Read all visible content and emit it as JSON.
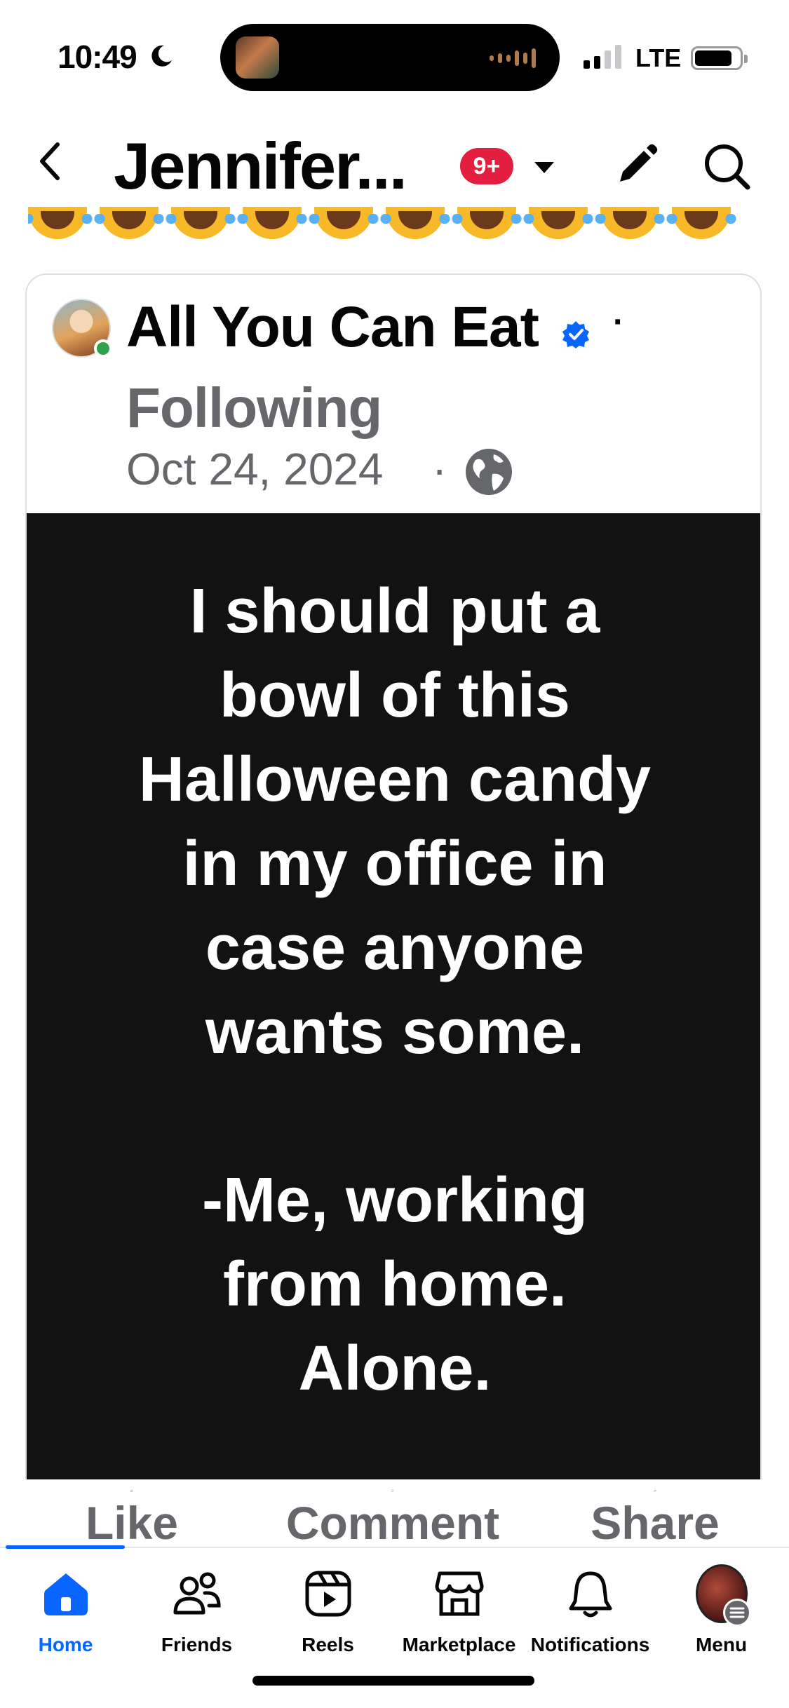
{
  "status_bar": {
    "time": "10:49",
    "network": "LTE"
  },
  "header": {
    "title": "Jennifer...",
    "badge": "9+"
  },
  "post": {
    "page_name": "All You Can Eat",
    "separator": "·",
    "follow_status": "Following",
    "date": "Oct 24, 2024",
    "date_separator": "·",
    "text": "I should put a\nbowl of this\nHalloween candy\nin my office in\ncase anyone\nwants some.\n\n-Me, working\nfrom home.\nAlone."
  },
  "actions": {
    "like": "Like",
    "comment": "Comment",
    "share": "Share"
  },
  "bottom_nav": {
    "home": "Home",
    "friends": "Friends",
    "reels": "Reels",
    "marketplace": "Marketplace",
    "notifications": "Notifications",
    "menu": "Menu"
  },
  "colors": {
    "accent": "#0866ff",
    "badge_red": "#e41e3f",
    "post_background": "#121212",
    "secondary_text": "#65676b",
    "online_green": "#31a24c"
  },
  "icons": [
    "back-chevron-icon",
    "caret-down-icon",
    "pencil-icon",
    "search-icon",
    "laughing-emoji-icon",
    "verified-badge-icon",
    "globe-icon",
    "like-icon",
    "comment-icon",
    "share-icon",
    "home-icon",
    "friends-icon",
    "reels-icon",
    "marketplace-icon",
    "bell-icon",
    "menu-icon"
  ]
}
